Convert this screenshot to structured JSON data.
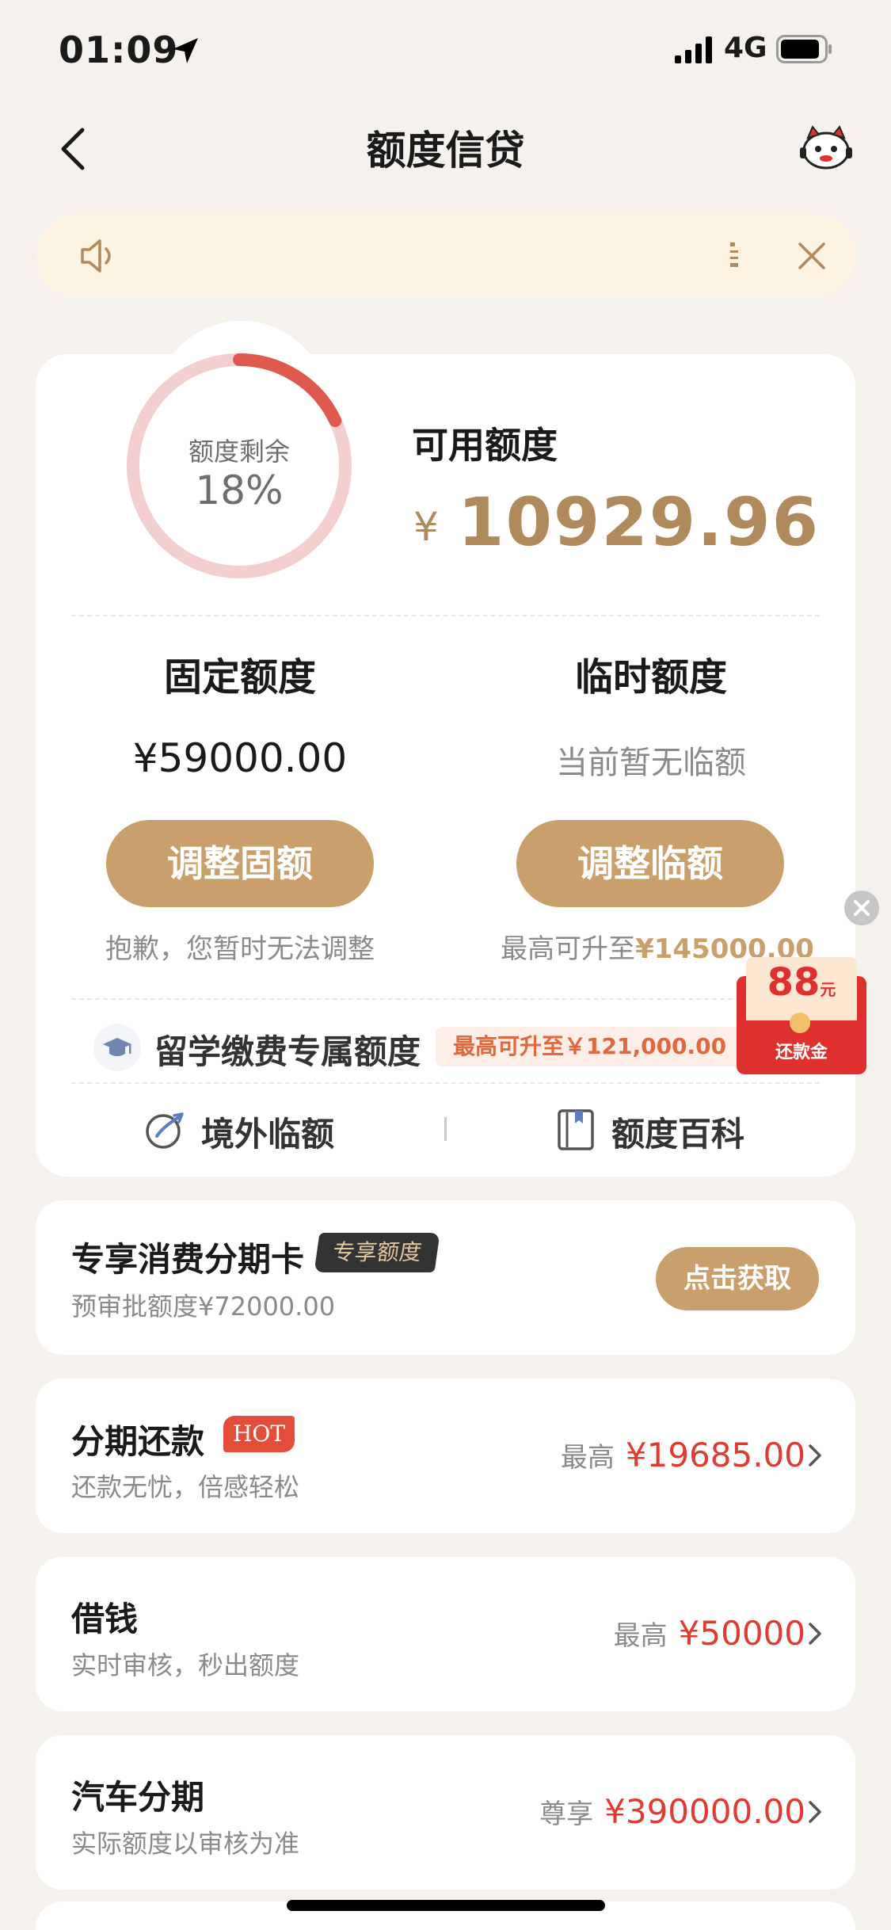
{
  "status_bar": {
    "time": "01:09",
    "network": "4G"
  },
  "header": {
    "title": "额度信贷"
  },
  "notice": {
    "text": ""
  },
  "credit": {
    "ring_label": "额度剩余",
    "ring_percent": "18%",
    "remaining_fraction": 0.18,
    "available_label": "可用额度",
    "currency": "¥",
    "available_amount": "10929.96",
    "fixed": {
      "title": "固定额度",
      "amount": "¥59000.00",
      "button": "调整固额",
      "note": "抱歉，您暂时无法调整"
    },
    "temporary": {
      "title": "临时额度",
      "status": "当前暂无临额",
      "button": "调整临额",
      "note_prefix": "最高可升至",
      "note_amount": "¥145000.00"
    },
    "study": {
      "title": "留学缴费专属额度",
      "badge": "最高可升至￥121,000.00"
    },
    "links": {
      "overseas": "境外临额",
      "wiki": "额度百科"
    }
  },
  "red_packet": {
    "amount": "88",
    "unit": "元",
    "label": "还款金"
  },
  "cards": [
    {
      "title": "专享消费分期卡",
      "tag": "专享额度",
      "subtitle": "预审批额度¥72000.00",
      "button": "点击获取"
    },
    {
      "title": "分期还款",
      "tag": "HOT",
      "subtitle": "还款无忧，倍感轻松",
      "prefix": "最高",
      "amount": "¥19685.00"
    },
    {
      "title": "借钱",
      "subtitle": "实时审核，秒出额度",
      "prefix": "最高",
      "amount": "¥50000"
    },
    {
      "title": "汽车分期",
      "subtitle": "实际额度以审核为准",
      "prefix": "尊享",
      "amount": "¥390000.00"
    }
  ],
  "colors": {
    "accent_gold": "#c9a06b",
    "amount_red": "#e03a32",
    "ring_red": "#e0594e",
    "ring_track": "#f3cfcf",
    "notice_bg": "#fdf3e1"
  },
  "icons": [
    "location-arrow-icon",
    "signal-icon",
    "battery-icon",
    "back-icon",
    "mascot-icon",
    "speaker-icon",
    "close-icon",
    "graduation-cap-icon",
    "globe-plane-icon",
    "book-icon",
    "chevron-right-icon"
  ]
}
